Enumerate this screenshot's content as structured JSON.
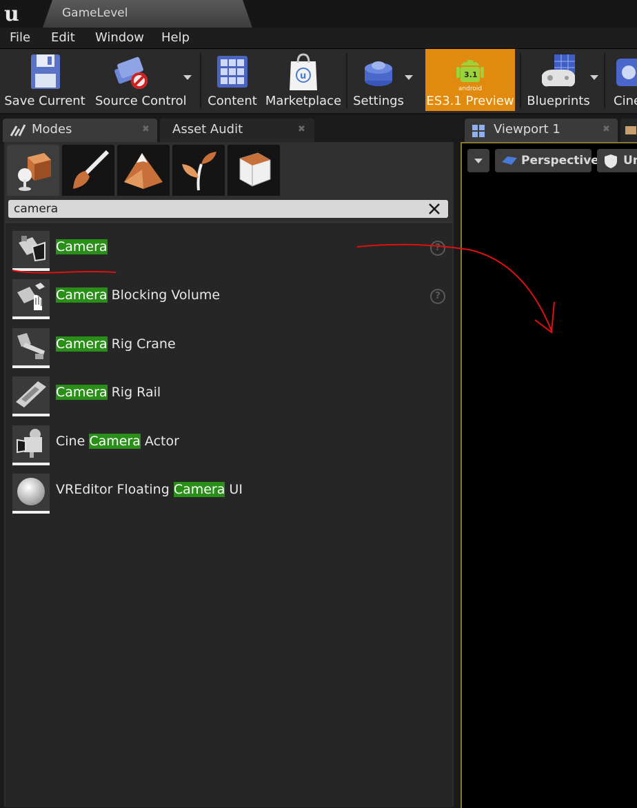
{
  "window": {
    "tab_title": "GameLevel"
  },
  "menu": {
    "items": [
      "File",
      "Edit",
      "Window",
      "Help"
    ]
  },
  "toolbar": {
    "buttons": [
      {
        "label": "Save Current",
        "icon": "save-icon"
      },
      {
        "label": "Source Control",
        "icon": "source-control-icon"
      },
      {
        "label": "Content",
        "icon": "content-icon"
      },
      {
        "label": "Marketplace",
        "icon": "marketplace-icon"
      },
      {
        "label": "Settings",
        "icon": "settings-icon"
      },
      {
        "label": "ES3.1 Preview",
        "icon": "android-icon",
        "badge": "3.1",
        "badge_text": "android"
      },
      {
        "label": "Blueprints",
        "icon": "blueprints-icon"
      },
      {
        "label": "Cine",
        "icon": "cinematics-icon"
      }
    ],
    "preview_color": "#e08a10"
  },
  "left_tabs": [
    {
      "label": "Modes",
      "icon": "modes-icon"
    },
    {
      "label": "Asset Audit"
    }
  ],
  "modes": {
    "mode_tabs": [
      "place-icon",
      "paint-icon",
      "landscape-icon",
      "foliage-icon",
      "geometry-icon"
    ],
    "search": {
      "value": "camera"
    },
    "results": [
      {
        "pre": "",
        "match": "Camera",
        "post": "",
        "icon": "camera-icon",
        "help": true
      },
      {
        "pre": "",
        "match": "Camera",
        "post": " Blocking Volume",
        "icon": "camera-blocking-volume-icon",
        "help": true
      },
      {
        "pre": "",
        "match": "Camera",
        "post": " Rig Crane",
        "icon": "rig-crane-icon",
        "help": false
      },
      {
        "pre": "",
        "match": "Camera",
        "post": " Rig Rail",
        "icon": "rig-rail-icon",
        "help": false
      },
      {
        "pre": "Cine ",
        "match": "Camera",
        "post": " Actor",
        "icon": "cine-camera-icon",
        "help": false
      },
      {
        "pre": "VREditor Floating ",
        "match": "Camera",
        "post": " UI",
        "icon": "sphere-icon",
        "help": false
      }
    ],
    "highlight_color": "#2a8f18"
  },
  "viewport": {
    "tab_label": "Viewport 1",
    "perspective_label": "Perspective",
    "lit_label": "Un"
  },
  "annotation_color": "#e01010"
}
